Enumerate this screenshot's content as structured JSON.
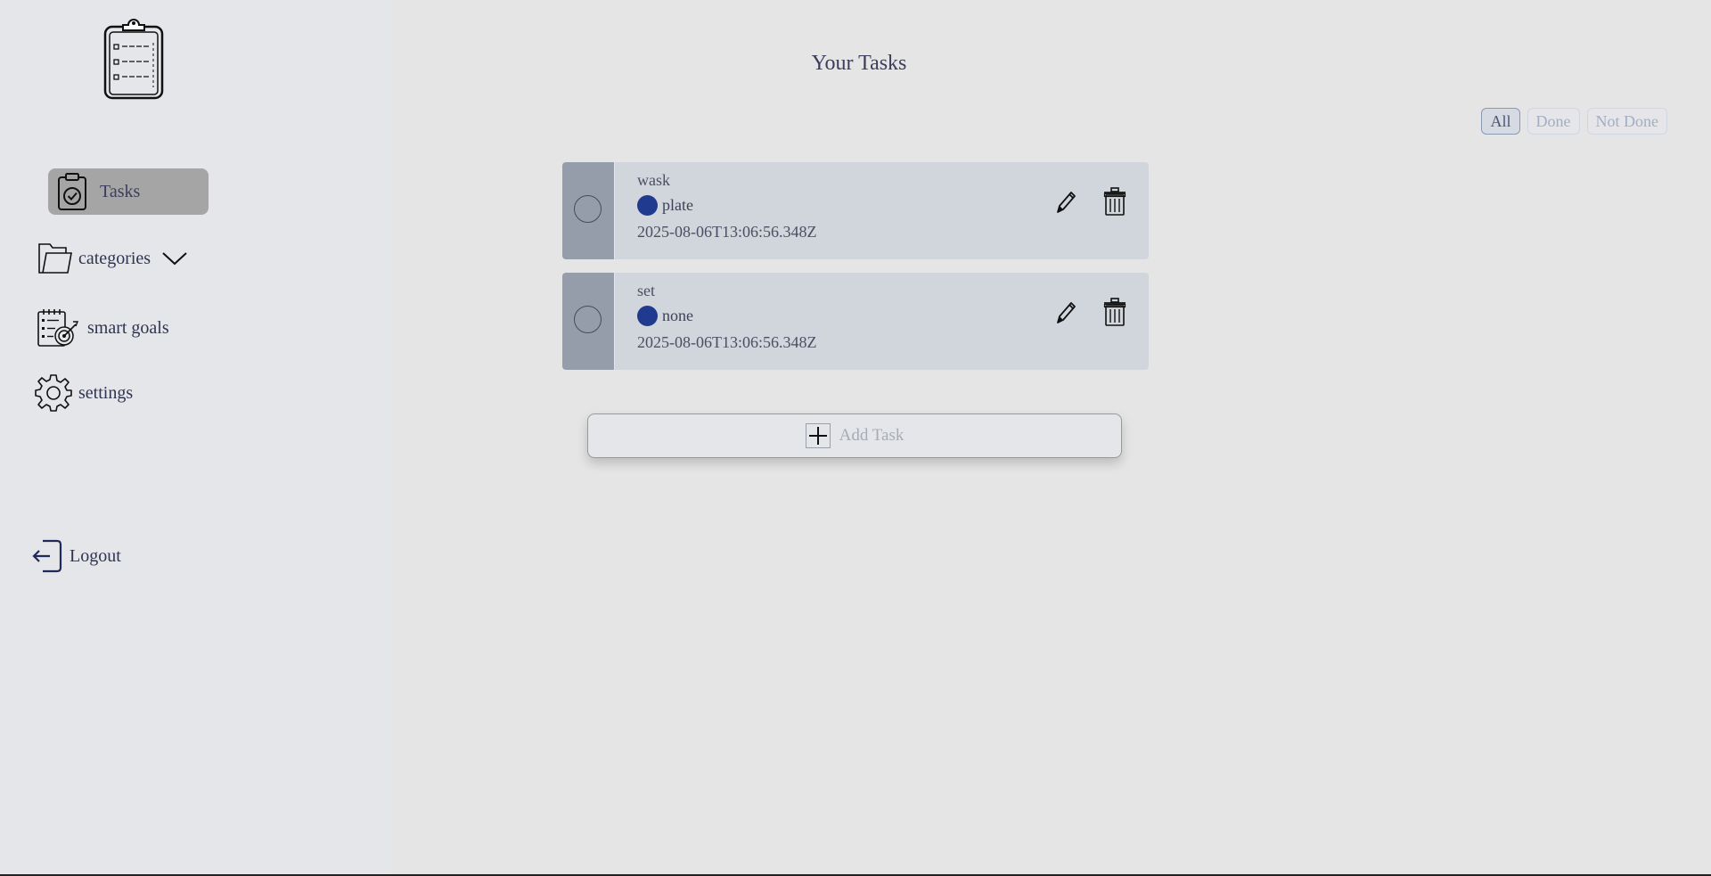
{
  "sidebar": {
    "items": [
      {
        "label": "Tasks",
        "icon": "clipboard-check-icon",
        "active": true
      },
      {
        "label": "categories",
        "icon": "folder-icon"
      },
      {
        "label": "smart goals",
        "icon": "goal-target-icon"
      },
      {
        "label": "settings",
        "icon": "gear-icon"
      }
    ],
    "logout_label": "Logout"
  },
  "header": {
    "title": "Your Tasks"
  },
  "filters": [
    {
      "label": "All",
      "active": true
    },
    {
      "label": "Done",
      "active": false
    },
    {
      "label": "Not Done",
      "active": false
    }
  ],
  "tasks": [
    {
      "name": "wask",
      "category": "plate",
      "category_color": "#1f3a8f",
      "date": "2025-08-06T13:06:56.348Z",
      "done": false
    },
    {
      "name": "set",
      "category": "none",
      "category_color": "#1f3a8f",
      "date": "2025-08-06T13:06:56.348Z",
      "done": false
    }
  ],
  "add_task_label": "Add Task",
  "colors": {
    "accent": "#1f3a8f",
    "sidebar_active": "#a5a5a5",
    "task_bg": "#d1d5dc",
    "check_col": "#959dab"
  }
}
